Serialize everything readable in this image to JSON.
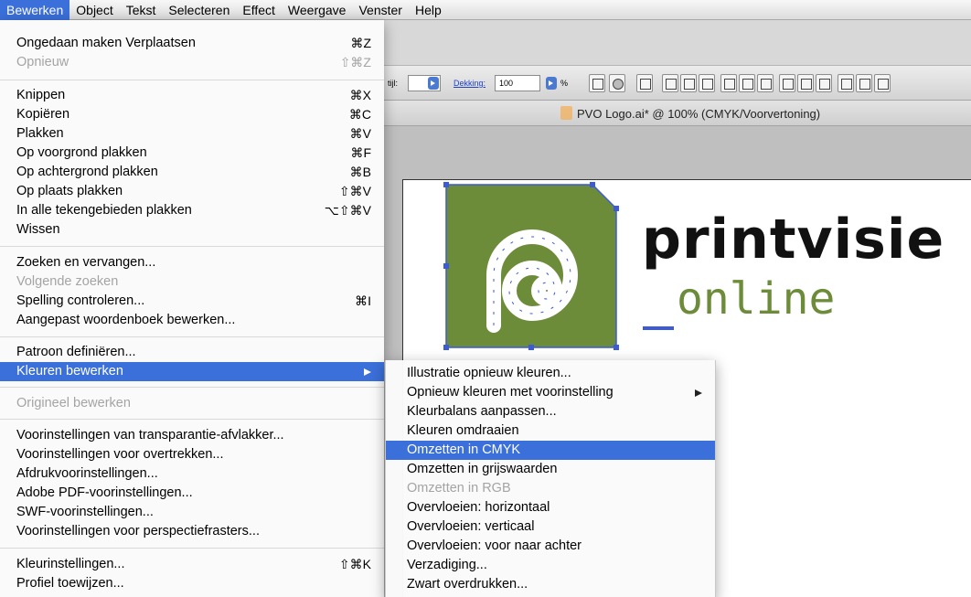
{
  "menubar": {
    "items": [
      "Bewerken",
      "Object",
      "Tekst",
      "Selecteren",
      "Effect",
      "Weergave",
      "Venster",
      "Help"
    ]
  },
  "controlbar": {
    "style_label": "tijl:",
    "opacity_label": "Dekking:",
    "opacity_value": "100",
    "percent": "%"
  },
  "document": {
    "tab_title": "PVO Logo.ai* @ 100% (CMYK/Voorvertoning)"
  },
  "logo": {
    "word1": "printvisie",
    "word2": "online",
    "green": "#6d8c3a",
    "selection": "#3d5bd6"
  },
  "main_menu": {
    "items": [
      {
        "label": "Ongedaan maken Verplaatsen",
        "shortcut": "⌘Z"
      },
      {
        "label": "Opnieuw",
        "shortcut": "⇧⌘Z"
      },
      {
        "label": "Knippen",
        "shortcut": "⌘X"
      },
      {
        "label": "Kopiëren",
        "shortcut": "⌘C"
      },
      {
        "label": "Plakken",
        "shortcut": "⌘V"
      },
      {
        "label": "Op voorgrond plakken",
        "shortcut": "⌘F"
      },
      {
        "label": "Op achtergrond plakken",
        "shortcut": "⌘B"
      },
      {
        "label": "Op plaats plakken",
        "shortcut": "⇧⌘V"
      },
      {
        "label": "In alle tekengebieden plakken",
        "shortcut": "⌥⇧⌘V"
      },
      {
        "label": "Wissen",
        "shortcut": ""
      },
      {
        "label": "Zoeken en vervangen...",
        "shortcut": ""
      },
      {
        "label": "Volgende zoeken",
        "shortcut": ""
      },
      {
        "label": "Spelling controleren...",
        "shortcut": "⌘I"
      },
      {
        "label": "Aangepast woordenboek bewerken...",
        "shortcut": ""
      },
      {
        "label": "Patroon definiëren...",
        "shortcut": ""
      },
      {
        "label": "Kleuren bewerken",
        "shortcut": ""
      },
      {
        "label": "Origineel bewerken",
        "shortcut": ""
      },
      {
        "label": "Voorinstellingen van transparantie-afvlakker...",
        "shortcut": ""
      },
      {
        "label": "Voorinstellingen voor overtrekken...",
        "shortcut": ""
      },
      {
        "label": "Afdrukvoorinstellingen...",
        "shortcut": ""
      },
      {
        "label": "Adobe PDF-voorinstellingen...",
        "shortcut": ""
      },
      {
        "label": "SWF-voorinstellingen...",
        "shortcut": ""
      },
      {
        "label": "Voorinstellingen voor perspectiefrasters...",
        "shortcut": ""
      },
      {
        "label": "Kleurinstellingen...",
        "shortcut": "⇧⌘K"
      },
      {
        "label": "Profiel toewijzen...",
        "shortcut": ""
      }
    ]
  },
  "sub_menu": {
    "items": [
      {
        "label": "Illustratie opnieuw kleuren..."
      },
      {
        "label": "Opnieuw kleuren met voorinstelling"
      },
      {
        "label": "Kleurbalans aanpassen..."
      },
      {
        "label": "Kleuren omdraaien"
      },
      {
        "label": "Omzetten in CMYK"
      },
      {
        "label": "Omzetten in grijswaarden"
      },
      {
        "label": "Omzetten in RGB"
      },
      {
        "label": "Overvloeien: horizontaal"
      },
      {
        "label": "Overvloeien: verticaal"
      },
      {
        "label": "Overvloeien: voor naar achter"
      },
      {
        "label": "Verzadiging..."
      },
      {
        "label": "Zwart overdrukken..."
      }
    ]
  }
}
